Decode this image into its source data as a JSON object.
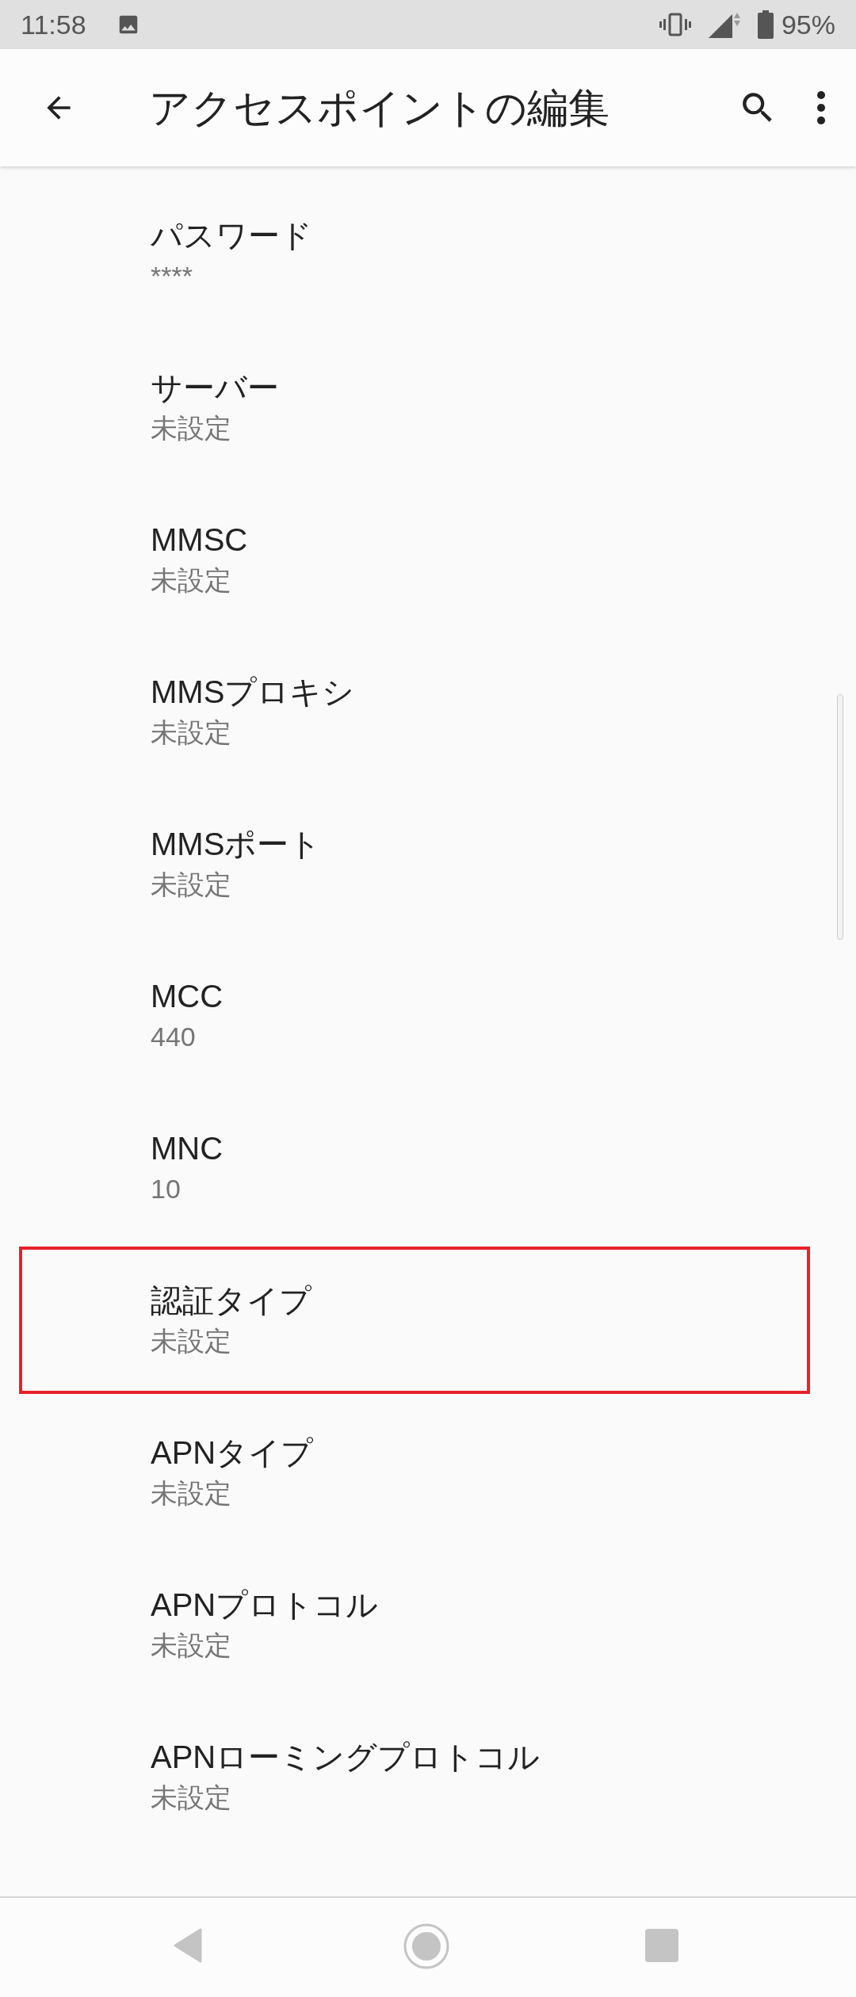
{
  "status_bar": {
    "time": "11:58",
    "battery": "95%"
  },
  "app_bar": {
    "title": "アクセスポイントの編集"
  },
  "settings": [
    {
      "title": "パスワード",
      "summary": "****",
      "highlighted": false
    },
    {
      "title": "サーバー",
      "summary": "未設定",
      "highlighted": false
    },
    {
      "title": "MMSC",
      "summary": "未設定",
      "highlighted": false
    },
    {
      "title": "MMSプロキシ",
      "summary": "未設定",
      "highlighted": false
    },
    {
      "title": "MMSポート",
      "summary": "未設定",
      "highlighted": false
    },
    {
      "title": "MCC",
      "summary": "440",
      "highlighted": false
    },
    {
      "title": "MNC",
      "summary": "10",
      "highlighted": false
    },
    {
      "title": "認証タイプ",
      "summary": "未設定",
      "highlighted": true
    },
    {
      "title": "APNタイプ",
      "summary": "未設定",
      "highlighted": false
    },
    {
      "title": "APNプロトコル",
      "summary": "未設定",
      "highlighted": false
    },
    {
      "title": "APNローミングプロトコル",
      "summary": "未設定",
      "highlighted": false
    }
  ]
}
